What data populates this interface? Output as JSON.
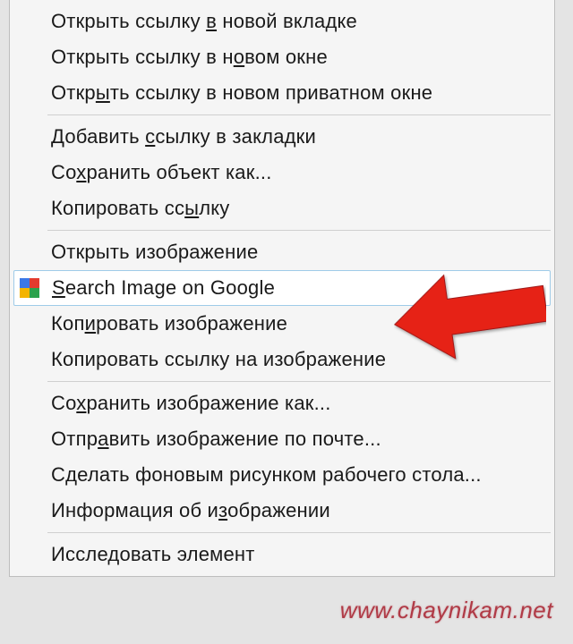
{
  "menu": {
    "groups": [
      [
        {
          "label": "Открыть ссылку в новой вкладке",
          "u": [
            15
          ]
        },
        {
          "label": "Открыть ссылку в новом окне",
          "u": [
            18
          ]
        },
        {
          "label": "Открыть ссылку в новом приватном окне",
          "u": [
            4
          ]
        }
      ],
      [
        {
          "label": "Добавить ссылку в закладки",
          "u": [
            9
          ]
        },
        {
          "label": "Сохранить объект как...",
          "u": [
            2
          ]
        },
        {
          "label": "Копировать ссылку",
          "u": [
            13
          ]
        }
      ],
      [
        {
          "label": "Открыть изображение",
          "u": []
        },
        {
          "label": "Search Image on Google",
          "u": [
            0
          ],
          "highlight": true,
          "icon": "google-favicon"
        },
        {
          "label": "Копировать изображение",
          "u": [
            3
          ]
        },
        {
          "label": "Копировать ссылку на изображение",
          "u": []
        }
      ],
      [
        {
          "label": "Сохранить изображение как...",
          "u": [
            2
          ]
        },
        {
          "label": "Отправить изображение по почте...",
          "u": [
            4
          ]
        },
        {
          "label": "Сделать фоновым рисунком рабочего стола...",
          "u": []
        },
        {
          "label": "Информация об изображении",
          "u": [
            15
          ]
        }
      ],
      [
        {
          "label": "Исследовать элемент",
          "u": []
        }
      ]
    ]
  },
  "arrow": {
    "color": "#e62117"
  },
  "watermark": "www.chaynikam.net"
}
